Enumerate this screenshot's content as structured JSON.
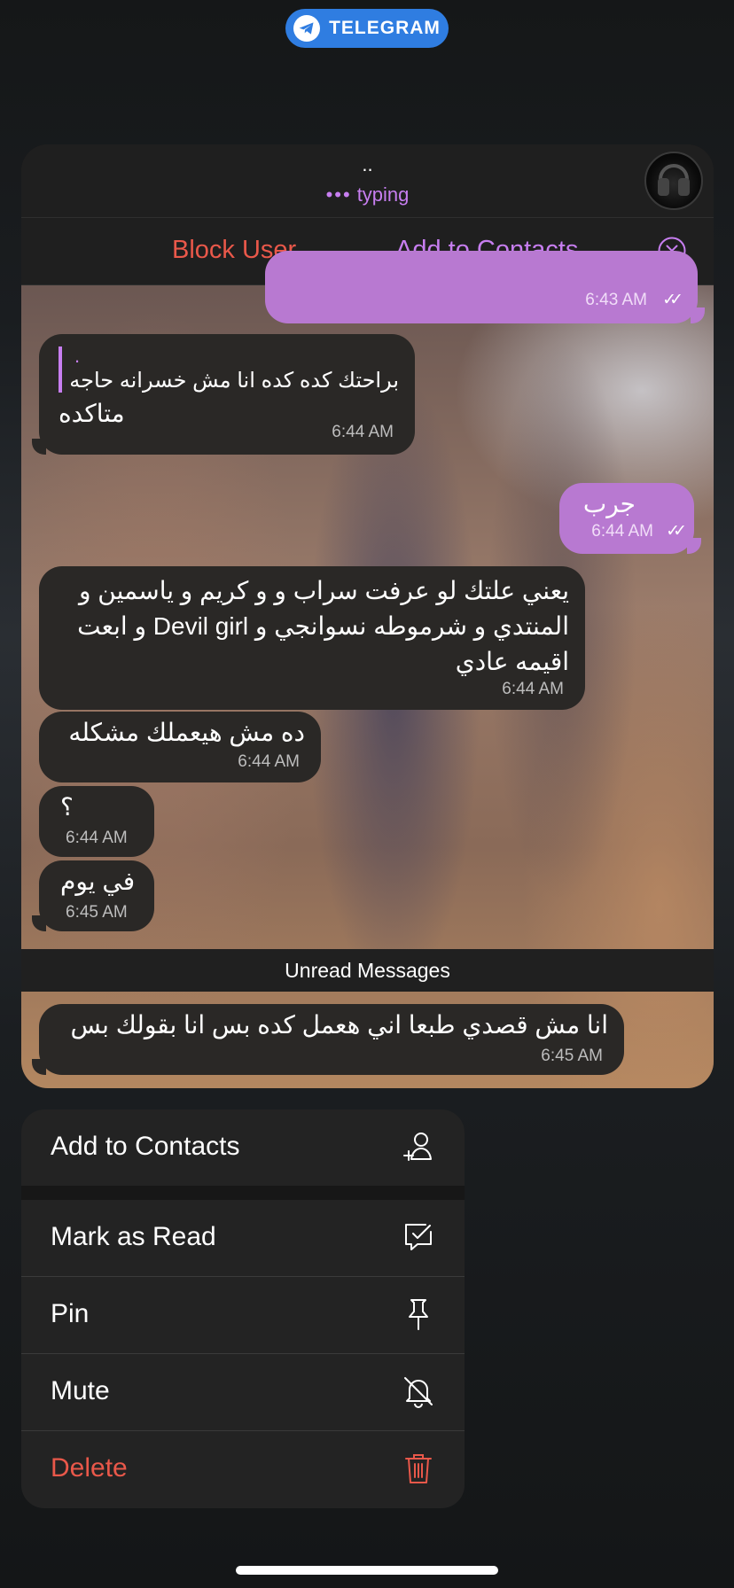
{
  "app_badge": {
    "label": "TELEGRAM"
  },
  "chat_header": {
    "name": "..",
    "status": "typing",
    "status_dots": "•••"
  },
  "action_bar": {
    "block_label": "Block User",
    "add_contacts_label": "Add to Contacts"
  },
  "messages": [
    {
      "dir": "out",
      "text": "",
      "time": "6:43 AM",
      "ticks": "✓✓"
    },
    {
      "dir": "in",
      "reply_title": ".",
      "reply_text": "براحتك كده كده انا مش خسرانه حاجه",
      "text": "متاكده",
      "time": "6:44 AM"
    },
    {
      "dir": "out",
      "text": "جرب",
      "time": "6:44 AM",
      "ticks": "✓✓"
    },
    {
      "dir": "in",
      "lines": [
        "يعني علتك لو عرفت سراب و و كريم و ياسمين و",
        "المنتدي و شرموطه نسوانجي و Devil girl  و ابعت",
        "اقيمه عادي"
      ],
      "time": "6:44 AM"
    },
    {
      "dir": "in",
      "text": "ده مش هيعملك مشكله",
      "time": "6:44 AM"
    },
    {
      "dir": "in",
      "text": "؟",
      "time": "6:44 AM"
    },
    {
      "dir": "in",
      "text": "في يوم",
      "time": "6:45 AM"
    },
    {
      "dir": "in",
      "text": "انا مش قصدي طبعا اني هعمل كده بس انا بقولك بس",
      "time": "6:45 AM"
    }
  ],
  "unread_label": "Unread Messages",
  "menu": {
    "add_contacts": "Add to Contacts",
    "mark_read": "Mark as Read",
    "pin": "Pin",
    "mute": "Mute",
    "delete": "Delete"
  },
  "colors": {
    "accent": "#c77ef0",
    "danger": "#e9584a",
    "tg_blue": "#2f7de1",
    "out_bubble": "#b879d1"
  },
  "icons": [
    "telegram-plane-icon",
    "close-circle-icon",
    "add-contact-icon",
    "mark-read-icon",
    "pin-icon",
    "mute-bell-icon",
    "trash-icon"
  ]
}
